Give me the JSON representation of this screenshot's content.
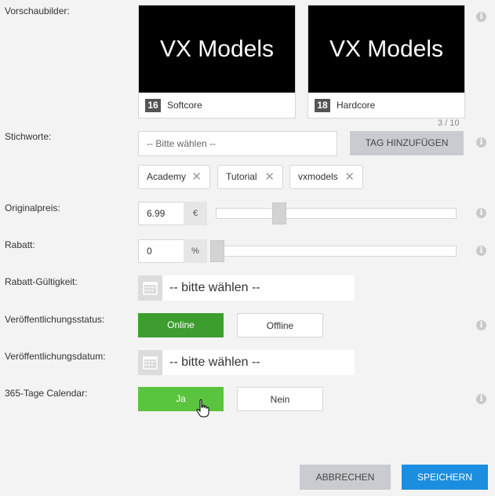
{
  "labels": {
    "preview": "Vorschaubilder:",
    "keywords": "Stichworte:",
    "original_price": "Originalpreis:",
    "discount": "Rabatt:",
    "discount_validity": "Rabatt-Gültigkeit:",
    "publish_status": "Veröffentlichungsstatus:",
    "publish_date": "Veröffentlichungsdatum:",
    "calendar": "365-Tage Calendar:"
  },
  "previews": [
    {
      "image_text": "VX Models",
      "rating": "16",
      "rating_label": "Softcore"
    },
    {
      "image_text": "VX Models",
      "rating": "18",
      "rating_label": "Hardcore"
    }
  ],
  "keywords": {
    "counter": "3 / 10",
    "placeholder": "-- Bitte wählen --",
    "add_button": "TAG HINZUFÜGEN",
    "tags": [
      "Academy",
      "Tutorial",
      "vxmodels"
    ]
  },
  "price": {
    "value": "6.99",
    "unit": "€",
    "slider_level": 0.25
  },
  "discount": {
    "value": "0",
    "unit": "%",
    "slider_level": 0.0
  },
  "discount_validity": {
    "placeholder": "-- bitte wählen --"
  },
  "publish_status": {
    "on_label": "Online",
    "off_label": "Offline",
    "selected": "Online"
  },
  "publish_date": {
    "placeholder": "-- bitte wählen --"
  },
  "calendar": {
    "on_label": "Ja",
    "off_label": "Nein",
    "selected": "Ja"
  },
  "footer": {
    "cancel": "ABBRECHEN",
    "save": "SPEICHERN"
  },
  "colors": {
    "green": "#3d9e2f",
    "green_hover": "#5bc43f",
    "blue": "#1c8ee0"
  }
}
